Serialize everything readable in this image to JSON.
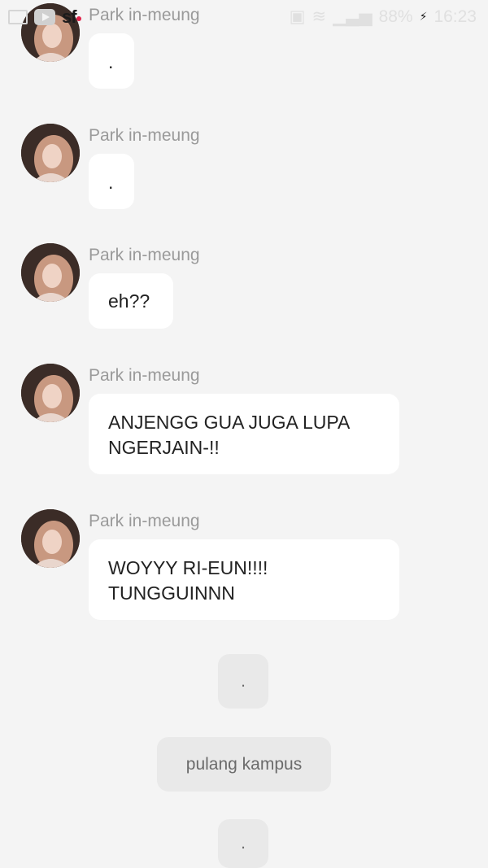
{
  "status_bar": {
    "battery": "88%",
    "time": "16:23",
    "icons": [
      "gallery-icon",
      "youtube-icon",
      "sf-app-icon",
      "sim-icon",
      "wifi-icon",
      "signal-icon",
      "battery-charging-icon"
    ]
  },
  "messages": [
    {
      "sender": "Park in-meung",
      "text": "."
    },
    {
      "sender": "Park in-meung",
      "text": "."
    },
    {
      "sender": "Park in-meung",
      "text": "eh??"
    },
    {
      "sender": "Park in-meung",
      "text": "ANJENGG GUA JUGA LUPA\nNGERJAIN-!!"
    },
    {
      "sender": "Park in-meung",
      "text": "WOYYY RI-EUN!!!!\nTUNGGUINNN"
    }
  ],
  "narrations": [
    {
      "text": "."
    },
    {
      "text": "pulang kampus"
    },
    {
      "text": "."
    }
  ],
  "colors": {
    "background": "#f4f4f4",
    "bubble": "#ffffff",
    "narration_bubble": "#e9e9e9",
    "sender_name": "#9a9a9a"
  }
}
